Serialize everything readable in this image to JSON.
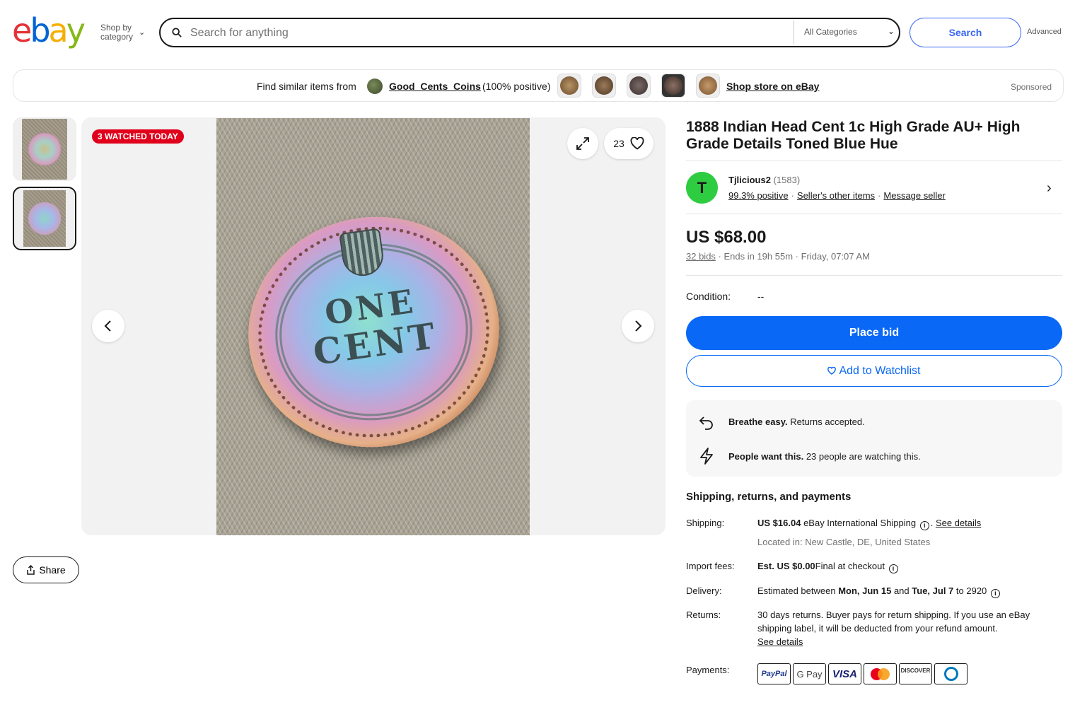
{
  "header": {
    "logo_letters": [
      "e",
      "b",
      "a",
      "y"
    ],
    "shop_by_category": "Shop by category",
    "search_placeholder": "Search for anything",
    "category_select": "All Categories",
    "search_button": "Search",
    "advanced_link": "Advanced"
  },
  "store_banner": {
    "prefix": "Find similar items from",
    "store_name": "Good_Cents_Coins",
    "positive": "(100% positive)",
    "shop_link": "Shop store on eBay",
    "sponsored": "Sponsored"
  },
  "gallery": {
    "watched_badge": "3 WATCHED TODAY",
    "watch_count": "23",
    "coin_text_line1": "ONE",
    "coin_text_line2": "CENT",
    "share_label": "Share"
  },
  "listing": {
    "title": "1888 Indian Head Cent 1c High Grade AU+ High Grade Details Toned Blue Hue",
    "seller": {
      "avatar_letter": "T",
      "name": "Tjlicious2",
      "feedback_count": "(1583)",
      "positive": "99.3% positive",
      "other_items": "Seller's other items",
      "message": "Message seller"
    },
    "price": "US $68.00",
    "bids": "32 bids",
    "ends": "Ends in 19h 55m · Friday, 07:07 AM",
    "condition_label": "Condition:",
    "condition_value": "--",
    "place_bid": "Place bid",
    "add_watchlist": "Add to Watchlist"
  },
  "signals": [
    {
      "bold": "Breathe easy.",
      "text": "Returns accepted.",
      "icon": "returns-icon"
    },
    {
      "bold": "People want this.",
      "text": "23 people are watching this.",
      "icon": "lightning-icon"
    }
  ],
  "shipping": {
    "heading": "Shipping, returns, and payments",
    "shipping_label": "Shipping:",
    "shipping_price": "US $16.04",
    "shipping_method": "eBay International Shipping",
    "shipping_see_details": "See details",
    "located": "Located in: New Castle, DE, United States",
    "import_label": "Import fees:",
    "import_value": "Est. US $0.00",
    "import_note": "Final at checkout",
    "delivery_label": "Delivery:",
    "delivery_prefix": "Estimated between",
    "delivery_start": "Mon, Jun 15",
    "delivery_and": "and",
    "delivery_end": "Tue, Jul 7",
    "delivery_suffix": "to 2920",
    "returns_label": "Returns:",
    "returns_text": "30 days returns. Buyer pays for return shipping. If you use an eBay shipping label, it will be deducted from your refund amount.",
    "returns_see_details": "See details",
    "payments_label": "Payments:",
    "payment_methods": [
      "PayPal",
      "G Pay",
      "VISA",
      "Mastercard",
      "DISCOVER",
      "Diners Club"
    ]
  }
}
